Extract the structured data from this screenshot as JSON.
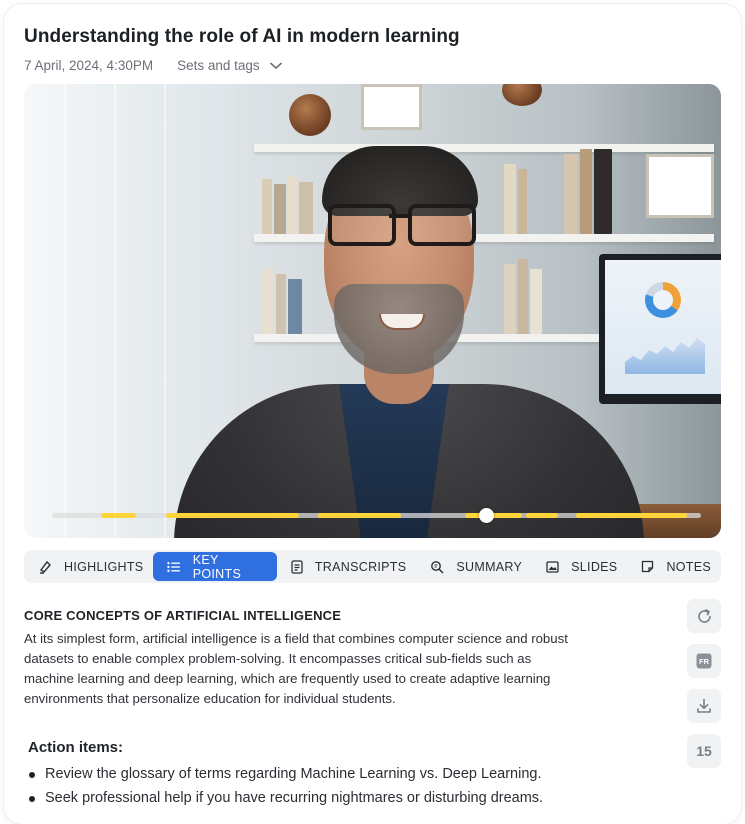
{
  "header": {
    "title": "Understanding the role of AI in modern learning",
    "date": "7 April, 2024, 4:30PM",
    "sets_label": "Sets and tags"
  },
  "video": {
    "description_icon": "video-player",
    "progress_fraction": 0.67,
    "highlight_segments": [
      {
        "start": 0.075,
        "end": 0.13
      },
      {
        "start": 0.175,
        "end": 0.38
      },
      {
        "start": 0.41,
        "end": 0.538
      },
      {
        "start": 0.636,
        "end": 0.724
      },
      {
        "start": 0.731,
        "end": 0.779
      },
      {
        "start": 0.808,
        "end": 0.978
      }
    ],
    "highlight_color": "#ffd43b"
  },
  "tabs": [
    {
      "label": "HIGHLIGHTS",
      "icon": "highlighter-icon",
      "active": false
    },
    {
      "label": "KEY POINTS",
      "icon": "list-icon",
      "active": true
    },
    {
      "label": "TRANSCRIPTS",
      "icon": "document-icon",
      "active": false
    },
    {
      "label": "SUMMARY",
      "icon": "magnifier-icon",
      "active": false
    },
    {
      "label": "SLIDES",
      "icon": "image-icon",
      "active": false
    },
    {
      "label": "NOTES",
      "icon": "note-icon",
      "active": false
    }
  ],
  "accent_color": "#2f6fe0",
  "content": {
    "section_title": "CORE CONCEPTS OF ARTIFICIAL INTELLIGENCE",
    "paragraph_lines": [
      "At its simplest form, artificial intelligence is a field that combines computer science and robust",
      "datasets to enable complex problem-solving. It encompasses critical sub-fields such as",
      "machine learning and deep learning, which are frequently used to create adaptive learning",
      "environments that personalize education for individual students."
    ],
    "actions_title": "Action items:",
    "action_items": [
      "Review the glossary of terms regarding Machine Learning vs. Deep Learning.",
      "Seek professional help if you have recurring nightmares or disturbing dreams."
    ]
  },
  "side_actions": {
    "regenerate_icon": "refresh-icon",
    "language_label": "FR",
    "download_icon": "download-icon",
    "count": "15"
  }
}
